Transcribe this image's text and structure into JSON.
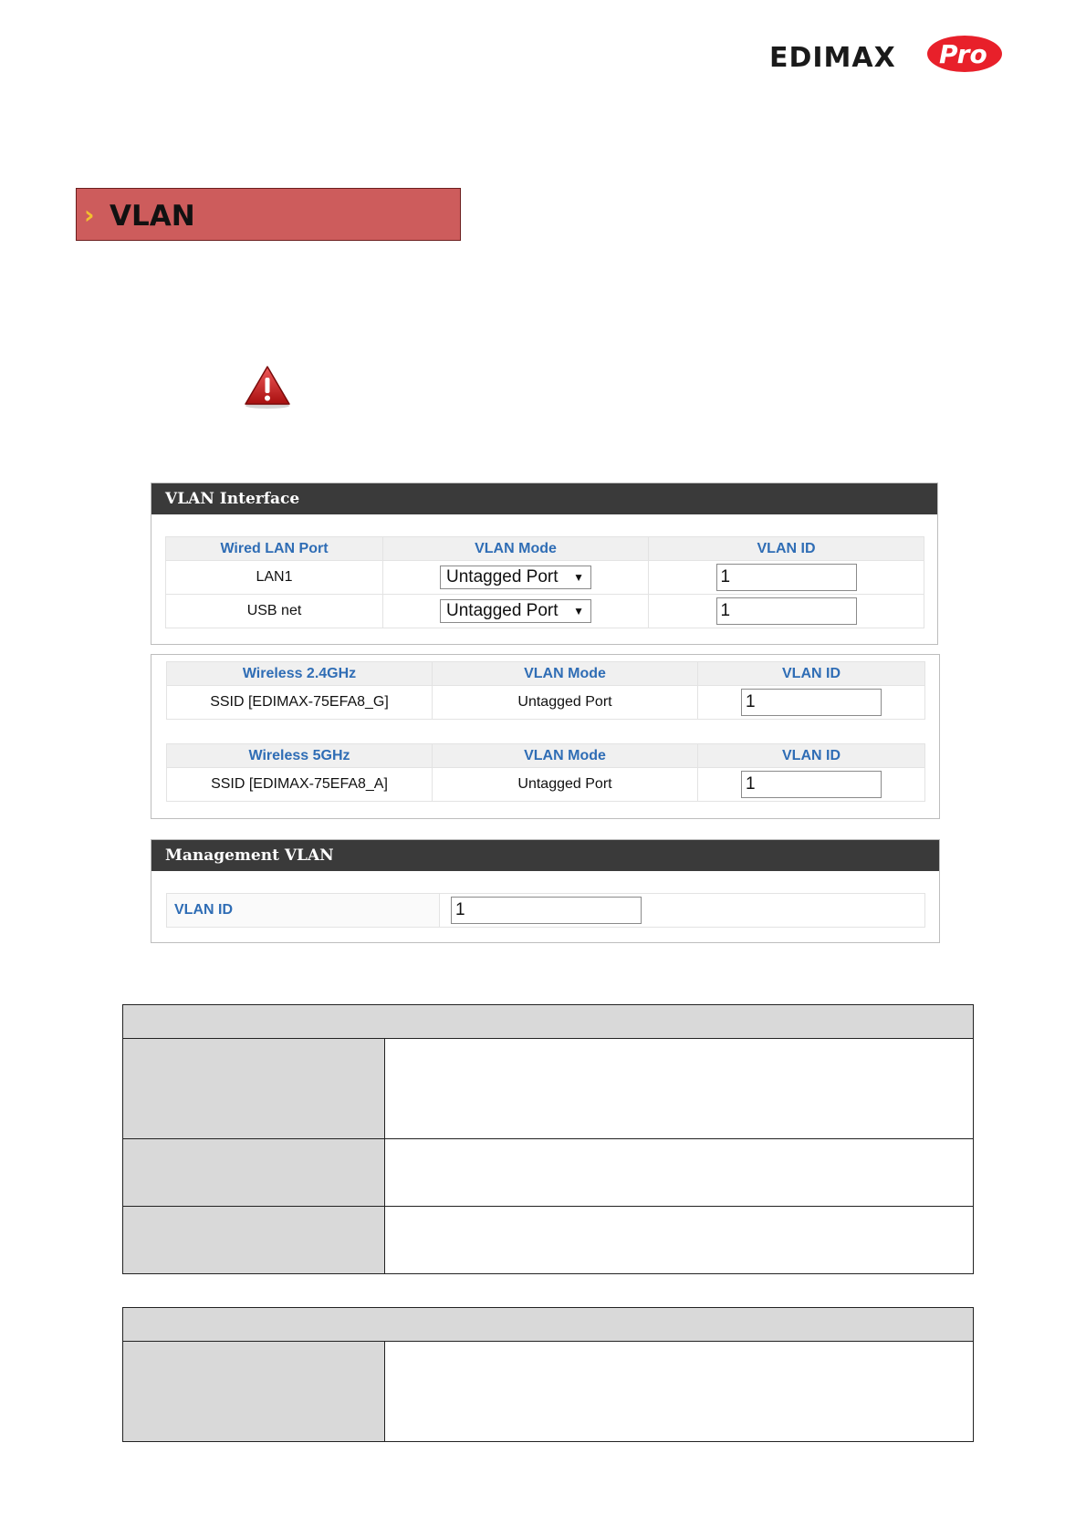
{
  "logo": {
    "brand": "EDIMAX",
    "suffix": "Pro",
    "brand_color": "#e8202a"
  },
  "section": {
    "title": "VLAN",
    "chevron": "›",
    "accent": "#cd5c5c"
  },
  "warning_icon": "warning-triangle-icon",
  "vlan_interface": {
    "title": "VLAN Interface",
    "wired": {
      "headers": [
        "Wired LAN Port",
        "VLAN Mode",
        "VLAN ID"
      ],
      "rows": [
        {
          "port": "LAN1",
          "mode": "Untagged Port",
          "vlan_id": "1"
        },
        {
          "port": "USB net",
          "mode": "Untagged Port",
          "vlan_id": "1"
        }
      ]
    },
    "wireless_24": {
      "headers": [
        "Wireless 2.4GHz",
        "VLAN Mode",
        "VLAN ID"
      ],
      "rows": [
        {
          "ssid": "SSID [EDIMAX-75EFA8_G]",
          "mode": "Untagged Port",
          "vlan_id": "1"
        }
      ]
    },
    "wireless_5": {
      "headers": [
        "Wireless 5GHz",
        "VLAN Mode",
        "VLAN ID"
      ],
      "rows": [
        {
          "ssid": "SSID [EDIMAX-75EFA8_A]",
          "mode": "Untagged Port",
          "vlan_id": "1"
        }
      ]
    }
  },
  "management_vlan": {
    "title": "Management VLAN",
    "label": "VLAN ID",
    "value": "1"
  },
  "header_color": "#3a3a3a",
  "column_header_color": "#2f6db5"
}
